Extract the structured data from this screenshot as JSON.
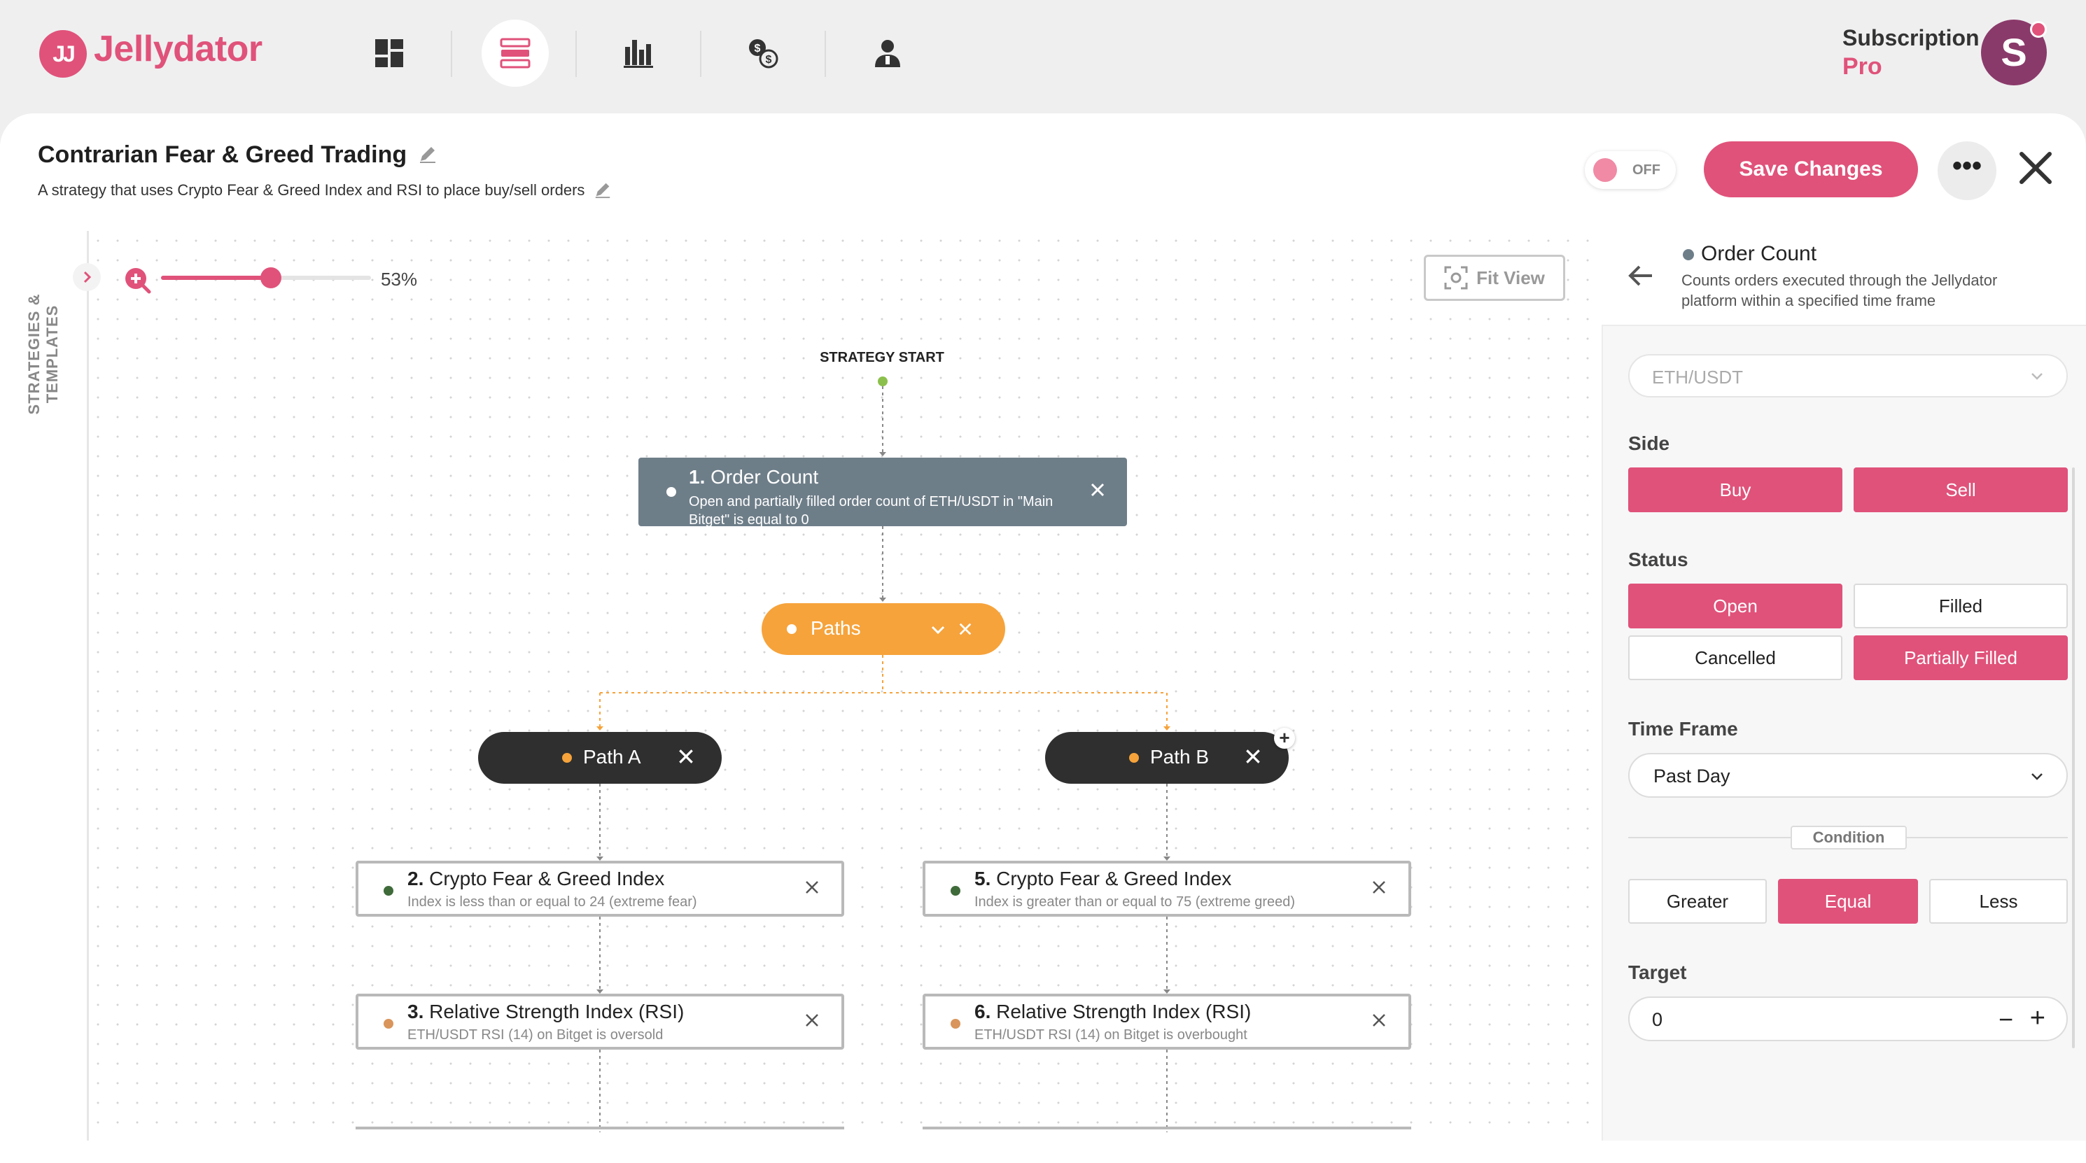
{
  "app": {
    "logo_mark": "JJ",
    "name": "Jellydator",
    "subscription_label": "Subscription",
    "subscription_plan": "Pro",
    "avatar_initial": "S",
    "brand_color": "#e0527a"
  },
  "nav": {
    "items": [
      {
        "name": "dashboard-icon"
      },
      {
        "name": "strategies-icon",
        "active": true
      },
      {
        "name": "analytics-icon"
      },
      {
        "name": "exchange-icon"
      },
      {
        "name": "account-icon"
      }
    ]
  },
  "strategy": {
    "title": "Contrarian Fear & Greed Trading",
    "description": "A strategy that uses Crypto Fear & Greed Index and RSI to place buy/sell orders",
    "toggle_label": "OFF",
    "save_label": "Save Changes",
    "more_label": "•••"
  },
  "canvas": {
    "side_label": "STRATEGIES & TEMPLATES",
    "zoom_value": "53%",
    "zoom_fraction": 0.53,
    "fit_view_label": "Fit View",
    "start_label": "STRATEGY START",
    "nodes": {
      "n1": {
        "number": "1.",
        "title": "Order Count",
        "desc": "Open and partially filled order count of ETH/USDT in \"Main Bitget\" is equal to 0"
      },
      "paths": {
        "title": "Paths"
      },
      "path_a": {
        "title": "Path A"
      },
      "path_b": {
        "title": "Path B"
      },
      "n2": {
        "number": "2.",
        "title": "Crypto Fear & Greed Index",
        "desc": "Index is less than or equal to 24 (extreme fear)"
      },
      "n3": {
        "number": "3.",
        "title": "Relative Strength Index (RSI)",
        "desc": "ETH/USDT RSI (14) on Bitget is oversold"
      },
      "n5": {
        "number": "5.",
        "title": "Crypto Fear & Greed Index",
        "desc": "Index is greater than or equal to 75 (extreme greed)"
      },
      "n6": {
        "number": "6.",
        "title": "Relative Strength Index (RSI)",
        "desc": "ETH/USDT RSI (14) on Bitget is overbought"
      }
    }
  },
  "panel": {
    "title": "Order Count",
    "description": "Counts orders executed through the Jellydator platform within a specified time frame",
    "pair": "ETH/USDT",
    "side": {
      "label": "Side",
      "options": [
        "Buy",
        "Sell"
      ]
    },
    "status": {
      "label": "Status",
      "options": [
        "Open",
        "Filled",
        "Cancelled",
        "Partially Filled"
      ]
    },
    "time_frame": {
      "label": "Time Frame",
      "value": "Past Day"
    },
    "condition": {
      "label": "Condition",
      "options": [
        "Greater",
        "Equal",
        "Less"
      ],
      "selected": "Equal"
    },
    "target": {
      "label": "Target",
      "value": "0",
      "minus": "−",
      "plus": "+"
    }
  }
}
